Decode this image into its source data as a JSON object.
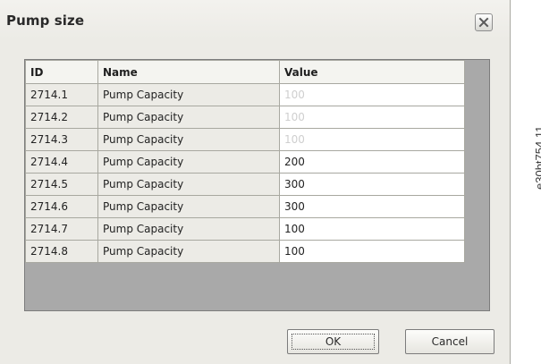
{
  "dialog": {
    "title": "Pump size",
    "close_icon": "close-x-icon"
  },
  "table": {
    "headers": {
      "id": "ID",
      "name": "Name",
      "value": "Value"
    },
    "rows": [
      {
        "id": "2714.1",
        "name": "Pump Capacity",
        "value": "100",
        "disabled": true
      },
      {
        "id": "2714.2",
        "name": "Pump Capacity",
        "value": "100",
        "disabled": true
      },
      {
        "id": "2714.3",
        "name": "Pump Capacity",
        "value": "100",
        "disabled": true
      },
      {
        "id": "2714.4",
        "name": "Pump Capacity",
        "value": "200",
        "disabled": false
      },
      {
        "id": "2714.5",
        "name": "Pump Capacity",
        "value": "300",
        "disabled": false
      },
      {
        "id": "2714.6",
        "name": "Pump Capacity",
        "value": "300",
        "disabled": false
      },
      {
        "id": "2714.7",
        "name": "Pump Capacity",
        "value": "100",
        "disabled": false
      },
      {
        "id": "2714.8",
        "name": "Pump Capacity",
        "value": "100",
        "disabled": false
      }
    ]
  },
  "buttons": {
    "ok": "OK",
    "cancel": "Cancel"
  },
  "side_label": "e30bt754.11"
}
